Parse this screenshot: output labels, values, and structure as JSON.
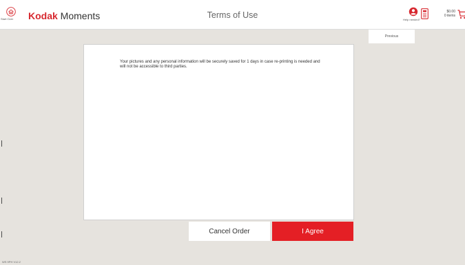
{
  "header": {
    "start_over_label": "Start Over",
    "brand_bold": "Kodak",
    "brand_rest": " Moments",
    "title": "Terms of Use",
    "help_label": "Help needed?",
    "cart": {
      "price": "$0.00",
      "items": "0 items"
    },
    "icons": [
      "home-icon",
      "user-circle-icon",
      "receipt-icon",
      "cart-icon"
    ]
  },
  "nav": {
    "previous_label": "Previous"
  },
  "terms": {
    "text": "Your pictures and any personal information will be securely saved for 1 days in case re-printing is needed and will not be accessible to third parties."
  },
  "actions": {
    "cancel_label": "Cancel Order",
    "agree_label": "I Agree"
  },
  "footer": {
    "version": "WS  9PH  V12.2"
  },
  "colors": {
    "brand_red": "#e41f25",
    "background": "#e6e3de",
    "panel": "#ffffff"
  }
}
